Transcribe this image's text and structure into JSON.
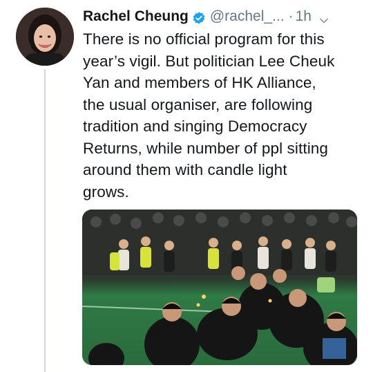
{
  "tweet": {
    "author": {
      "display_name": "Rachel Cheung",
      "handle": "@rachel_...",
      "verified": true
    },
    "separator": "·",
    "time": "1h",
    "text": "There is no official program for this\nyear’s vigil. But politician Lee Cheuk\nYan and members of HK Alliance,\nthe usual organiser, are following\ntradition and singing Democracy\nReturns, while number of ppl sitting\naround them with candle light\ngrows.",
    "media": {
      "kind": "photo",
      "description_icon": "crowd-photo"
    }
  },
  "colors": {
    "verified_badge": "#1da1f2",
    "secondary_text": "#657786",
    "primary_text": "#14171a"
  }
}
